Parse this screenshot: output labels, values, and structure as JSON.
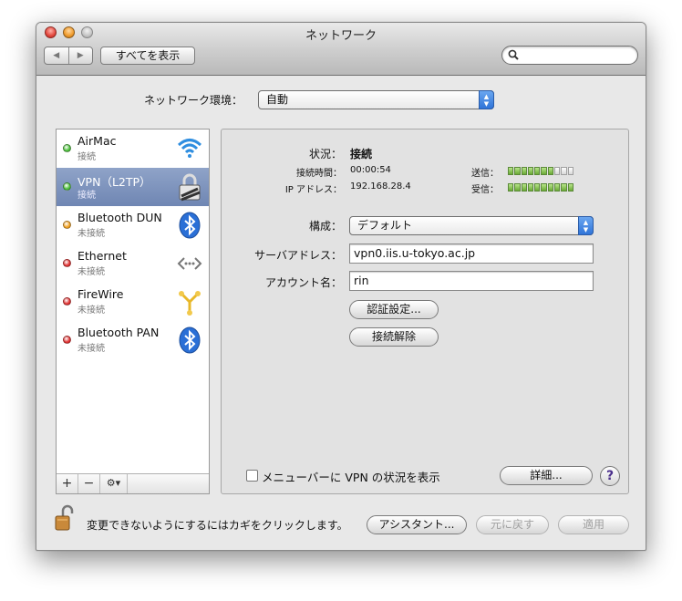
{
  "window": {
    "title": "ネットワーク",
    "show_all_label": "すべてを表示",
    "search": {
      "value": "",
      "placeholder": ""
    }
  },
  "location": {
    "label": "ネットワーク環境：",
    "value": "自動"
  },
  "services": [
    {
      "name": "AirMac",
      "status": "接続",
      "status_color": "#4cc03a",
      "icon": "wifi-icon",
      "selected": false
    },
    {
      "name": "VPN（L2TP）",
      "status": "接続",
      "status_color": "#4cc03a",
      "icon": "vpn-lock-icon",
      "selected": true
    },
    {
      "name": "Bluetooth DUN",
      "status": "未接続",
      "status_color": "#f0a020",
      "icon": "bluetooth-icon",
      "selected": false
    },
    {
      "name": "Ethernet",
      "status": "未接続",
      "status_color": "#e03030",
      "icon": "ethernet-icon",
      "selected": false
    },
    {
      "name": "FireWire",
      "status": "未接続",
      "status_color": "#e03030",
      "icon": "firewire-icon",
      "selected": false
    },
    {
      "name": "Bluetooth PAN",
      "status": "未接続",
      "status_color": "#e03030",
      "icon": "bluetooth-icon",
      "selected": false
    }
  ],
  "sidebar_bar": {
    "add": "+",
    "remove": "−",
    "gear": "⚙▾"
  },
  "detail": {
    "status_label": "状況：",
    "status_value": "接続",
    "connect_time_label": "接続時間：",
    "connect_time_value": "00:00:54",
    "ip_label": "IP アドレス：",
    "ip_value": "192.168.28.4",
    "send_label": "送信：",
    "recv_label": "受信：",
    "send_level": 0.7,
    "recv_level": 1.0,
    "config_label": "構成：",
    "config_value": "デフォルト",
    "server_label": "サーバアドレス：",
    "server_value": "vpn0.iis.u-tokyo.ac.jp",
    "account_label": "アカウント名：",
    "account_value": "rin",
    "auth_button": "認証設定...",
    "disconnect_button": "接続解除",
    "menubar_checkbox_label": "メニューバーに VPN の状況を表示",
    "menubar_checked": false,
    "advanced_button": "詳細...",
    "help": "?"
  },
  "footer": {
    "lock_text": "変更できないようにするにはカギをクリックします。",
    "assistant_button": "アシスタント...",
    "revert_button": "元に戻す",
    "apply_button": "適用"
  },
  "colors": {
    "accent_blue": "#2f74d8",
    "selection": "#7a8fbb",
    "meter_on": "#6aaa36"
  }
}
